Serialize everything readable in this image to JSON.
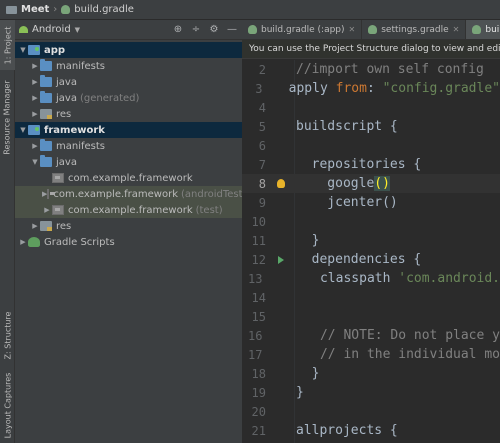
{
  "breadcrumb": {
    "project": "Meet",
    "file": "build.gradle"
  },
  "tool_strip": {
    "project_tab": "1: Project",
    "resource_manager_tab": "Resource Manager",
    "structure_tab": "Z: Structure",
    "layout_captures_tab": "Layout Captures"
  },
  "project_panel": {
    "view_label": "Android",
    "tree": [
      {
        "label": "app",
        "suffix": ""
      },
      {
        "label": "manifests",
        "suffix": ""
      },
      {
        "label": "java",
        "suffix": ""
      },
      {
        "label": "java",
        "suffix": "(generated)"
      },
      {
        "label": "res",
        "suffix": ""
      },
      {
        "label": "framework",
        "suffix": ""
      },
      {
        "label": "manifests",
        "suffix": ""
      },
      {
        "label": "java",
        "suffix": ""
      },
      {
        "label": "com.example.framework",
        "suffix": ""
      },
      {
        "label": "com.example.framework",
        "suffix": "(androidTest)"
      },
      {
        "label": "com.example.framework",
        "suffix": "(test)"
      },
      {
        "label": "res",
        "suffix": ""
      },
      {
        "label": "Gradle Scripts",
        "suffix": ""
      }
    ]
  },
  "editor": {
    "tabs": [
      {
        "label": "build.gradle (:app)"
      },
      {
        "label": "settings.gradle"
      },
      {
        "label": "build.gradle (Me"
      }
    ],
    "notice": "You can use the Project Structure dialog to view and edit your",
    "lines": [
      {
        "num": "2",
        "text": "//import own self config"
      },
      {
        "num": "3",
        "t1": "apply ",
        "t2": "from",
        "t3": ": ",
        "t4": "\"config.gradle\""
      },
      {
        "num": "4",
        "text": ""
      },
      {
        "num": "5",
        "text": "buildscript {"
      },
      {
        "num": "6",
        "text": ""
      },
      {
        "num": "7",
        "text": "  repositories {"
      },
      {
        "num": "8",
        "t1": "    google",
        "t2": "(",
        "t3": ")"
      },
      {
        "num": "9",
        "text": "    jcenter()"
      },
      {
        "num": "10",
        "text": ""
      },
      {
        "num": "11",
        "text": "  }"
      },
      {
        "num": "12",
        "text": "  dependencies {"
      },
      {
        "num": "13",
        "t1": "    classpath ",
        "t2": "'com.android."
      },
      {
        "num": "14",
        "text": ""
      },
      {
        "num": "15",
        "text": ""
      },
      {
        "num": "16",
        "text": "    // NOTE: Do not place y"
      },
      {
        "num": "17",
        "text": "    // in the individual mo"
      },
      {
        "num": "18",
        "text": "  }"
      },
      {
        "num": "19",
        "text": "}"
      },
      {
        "num": "20",
        "text": ""
      },
      {
        "num": "21",
        "text": "allprojects {"
      }
    ]
  },
  "colors": {
    "panel_bg": "#3c3f41",
    "editor_bg": "#2b2b2b",
    "selection": "#0d293e",
    "keyword": "#cc7832",
    "string": "#6a8759",
    "comment": "#808080"
  }
}
